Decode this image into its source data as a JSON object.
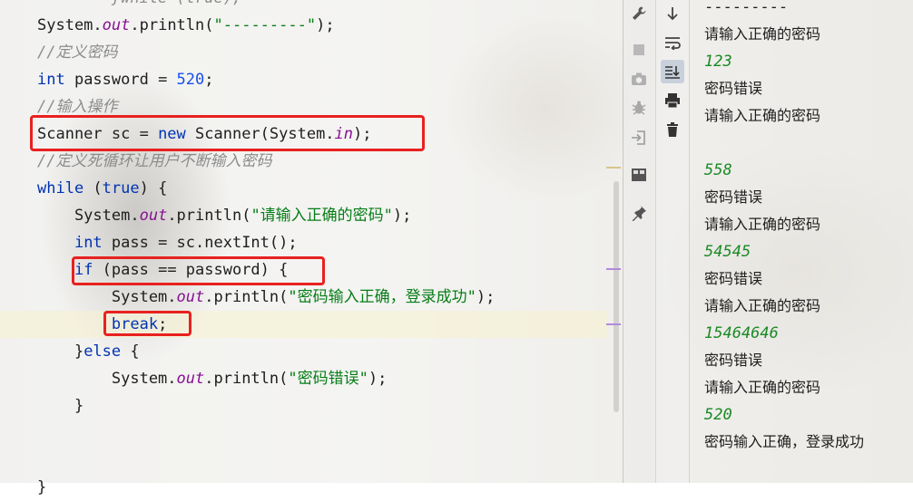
{
  "editor": {
    "lines": [
      {
        "segments": [
          {
            "t": "        }while (true);",
            "c": "cm"
          }
        ]
      },
      {
        "segments": [
          {
            "t": "System."
          },
          {
            "t": "out",
            "c": "fld"
          },
          {
            "t": ".println("
          },
          {
            "t": "\"---------\"",
            "c": "st"
          },
          {
            "t": ");"
          }
        ]
      },
      {
        "segments": [
          {
            "t": "//定义密码",
            "c": "cm"
          }
        ]
      },
      {
        "segments": [
          {
            "t": "int",
            "c": "kw"
          },
          {
            "t": " password = "
          },
          {
            "t": "520",
            "c": "num"
          },
          {
            "t": ";"
          }
        ]
      },
      {
        "segments": [
          {
            "t": "//输入操作",
            "c": "cm"
          }
        ]
      },
      {
        "segments": [
          {
            "t": "Scanner sc = "
          },
          {
            "t": "new",
            "c": "kw"
          },
          {
            "t": " Scanner(System."
          },
          {
            "t": "in",
            "c": "fld"
          },
          {
            "t": ");"
          }
        ]
      },
      {
        "segments": [
          {
            "t": "//定义死循环让用户不断输入密码",
            "c": "cm"
          }
        ]
      },
      {
        "segments": [
          {
            "t": "while",
            "c": "kw"
          },
          {
            "t": " ("
          },
          {
            "t": "true",
            "c": "kw"
          },
          {
            "t": ") {"
          }
        ]
      },
      {
        "segments": [
          {
            "t": "    System."
          },
          {
            "t": "out",
            "c": "fld"
          },
          {
            "t": ".println("
          },
          {
            "t": "\"请输入正确的密码\"",
            "c": "st"
          },
          {
            "t": ");"
          }
        ]
      },
      {
        "segments": [
          {
            "t": "    "
          },
          {
            "t": "int",
            "c": "kw"
          },
          {
            "t": " pass = sc.nextInt();"
          }
        ]
      },
      {
        "segments": [
          {
            "t": "    "
          },
          {
            "t": "if",
            "c": "kw"
          },
          {
            "t": " (pass == password) {"
          }
        ]
      },
      {
        "segments": [
          {
            "t": "        System."
          },
          {
            "t": "out",
            "c": "fld"
          },
          {
            "t": ".println("
          },
          {
            "t": "\"密码输入正确，登录成功\"",
            "c": "st"
          },
          {
            "t": ");"
          }
        ]
      },
      {
        "segments": [
          {
            "t": "        "
          },
          {
            "t": "break",
            "c": "kw"
          },
          {
            "t": ";"
          }
        ]
      },
      {
        "segments": [
          {
            "t": "    }"
          },
          {
            "t": "else",
            "c": "kw"
          },
          {
            "t": " {"
          }
        ]
      },
      {
        "segments": [
          {
            "t": "        System."
          },
          {
            "t": "out",
            "c": "fld"
          },
          {
            "t": ".println("
          },
          {
            "t": "\"密码错误\"",
            "c": "st"
          },
          {
            "t": ");"
          }
        ]
      },
      {
        "segments": [
          {
            "t": "    }"
          }
        ]
      },
      {
        "segments": [
          {
            "t": ""
          }
        ]
      },
      {
        "segments": [
          {
            "t": ""
          }
        ]
      },
      {
        "segments": [
          {
            "t": "}"
          }
        ]
      }
    ]
  },
  "toolbar_left": {
    "icons": [
      "wrench-icon",
      "stop-icon",
      "camera-icon",
      "debug-icon",
      "login-icon",
      "layout-icon",
      "pin-icon"
    ]
  },
  "toolbar_right": {
    "icons": [
      "scroll-down-icon",
      "soft-wrap-icon",
      "scroll-to-end-icon",
      "print-icon",
      "trash-icon"
    ]
  },
  "console": {
    "lines": [
      {
        "text": "---------",
        "type": "out"
      },
      {
        "text": "请输入正确的密码",
        "type": "out"
      },
      {
        "text": "123",
        "type": "input"
      },
      {
        "text": "密码错误",
        "type": "out"
      },
      {
        "text": "请输入正确的密码",
        "type": "out"
      },
      {
        "text": "",
        "type": "out"
      },
      {
        "text": "558",
        "type": "input"
      },
      {
        "text": "密码错误",
        "type": "out"
      },
      {
        "text": "请输入正确的密码",
        "type": "out"
      },
      {
        "text": "54545",
        "type": "input"
      },
      {
        "text": "密码错误",
        "type": "out"
      },
      {
        "text": "请输入正确的密码",
        "type": "out"
      },
      {
        "text": "15464646",
        "type": "input"
      },
      {
        "text": "密码错误",
        "type": "out"
      },
      {
        "text": "请输入正确的密码",
        "type": "out"
      },
      {
        "text": "520",
        "type": "input"
      },
      {
        "text": "密码输入正确，登录成功",
        "type": "out"
      }
    ]
  },
  "colors": {
    "highlight_box": "#e8211f",
    "keyword": "#0033b3",
    "string": "#067d17",
    "number": "#1750eb",
    "field": "#871094",
    "comment": "#8c8c8c",
    "console_input": "#1a8a24"
  }
}
